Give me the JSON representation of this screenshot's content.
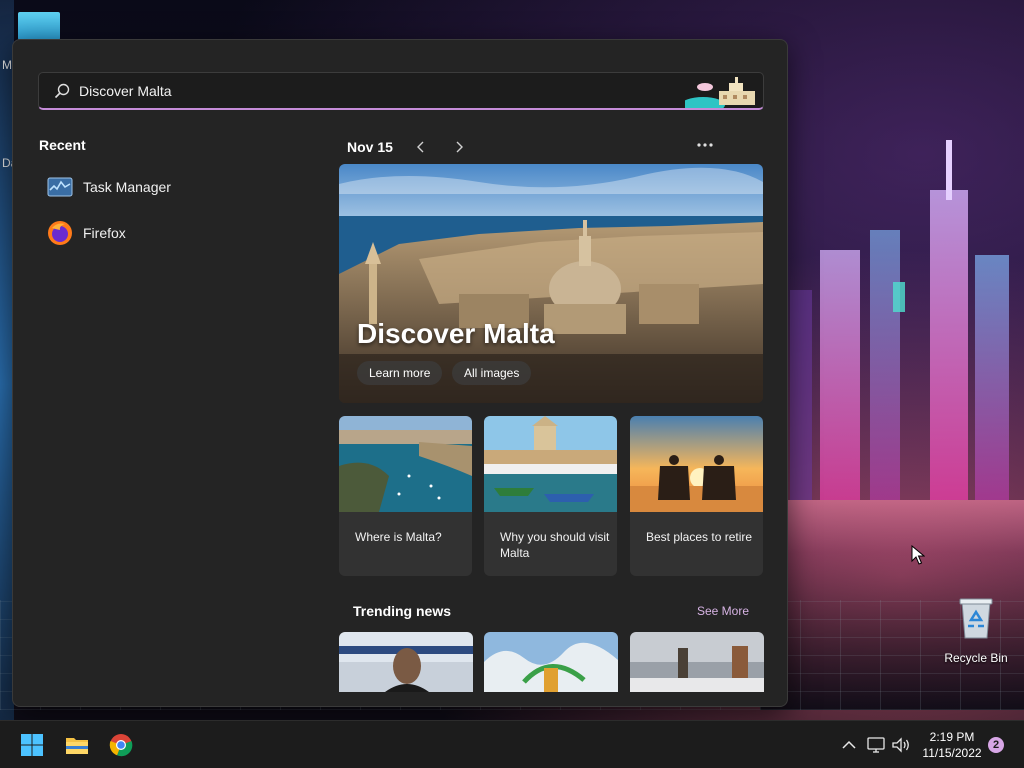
{
  "desktop": {
    "edge_letters": [
      "M",
      "Da"
    ],
    "recycle_bin_label": "Recycle Bin"
  },
  "search": {
    "value": "Discover Malta",
    "placeholder": "",
    "search_icon": "search-icon"
  },
  "recent": {
    "heading": "Recent",
    "items": [
      {
        "label": "Task Manager",
        "icon": "task-manager-icon"
      },
      {
        "label": "Firefox",
        "icon": "firefox-icon"
      }
    ]
  },
  "highlights": {
    "date": "Nov 15",
    "prev_icon": "chevron-left-icon",
    "next_icon": "chevron-right-icon",
    "more_icon": "more-icon",
    "hero": {
      "title": "Discover Malta",
      "learn_more_label": "Learn more",
      "all_images_label": "All images"
    },
    "topics": [
      {
        "label": "Where is Malta?"
      },
      {
        "label": "Why you should visit Malta"
      },
      {
        "label": "Best places to retire"
      }
    ],
    "trending": {
      "heading": "Trending news",
      "see_more_label": "See More"
    }
  },
  "taskbar": {
    "icons": [
      "windows-start-icon",
      "file-explorer-icon",
      "chrome-icon"
    ],
    "tray_icons": [
      "chevron-up-icon",
      "network-icon",
      "volume-icon"
    ],
    "time": "2:19 PM",
    "date": "11/15/2022",
    "notification_count": "2"
  },
  "colors": {
    "accent": "#c58cd8",
    "panel_bg": "#242424",
    "taskbar_bg": "#1c1c1c"
  }
}
